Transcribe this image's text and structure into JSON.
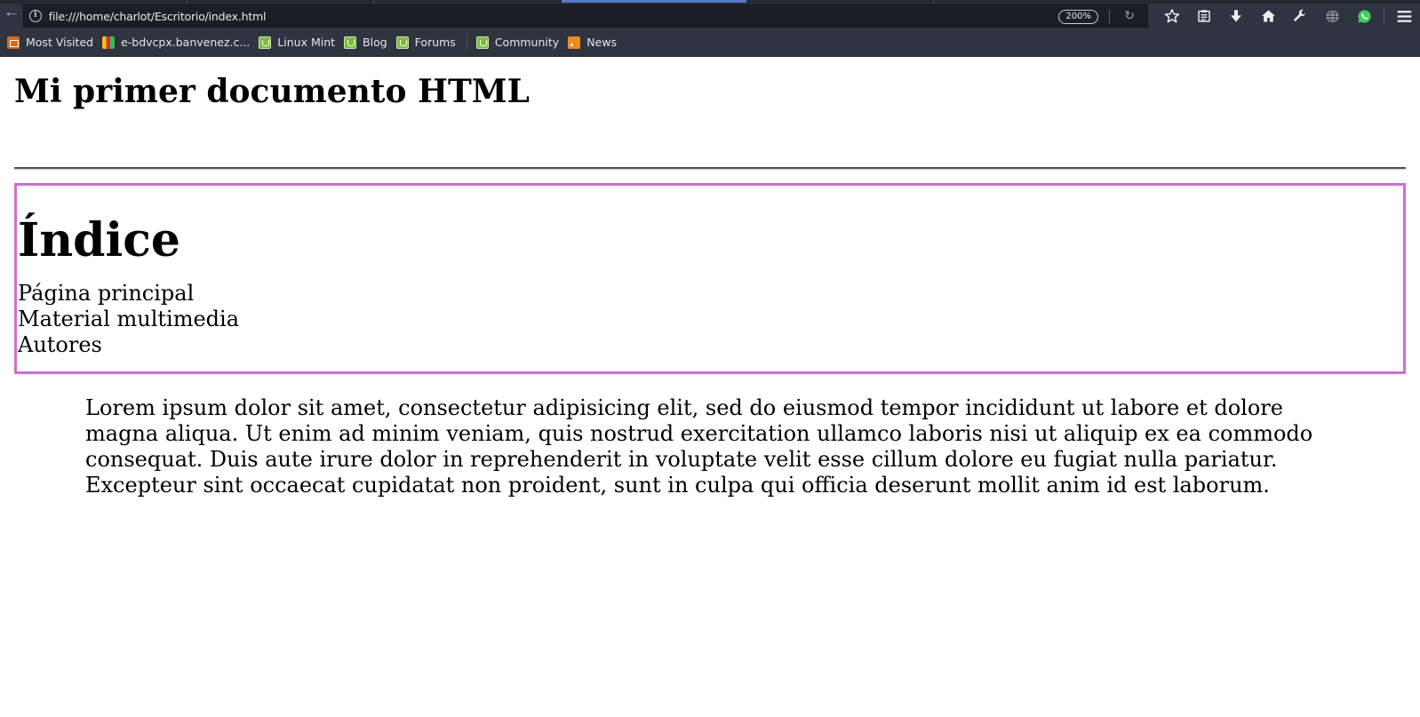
{
  "browser": {
    "url": "file:///home/charlot/Escritorio/index.html",
    "zoom": "200%",
    "toolbar_icons": [
      "star-icon",
      "reading-list-icon",
      "download-icon",
      "home-icon",
      "wrench-icon",
      "globe-icon",
      "whatsapp-icon",
      "menu-icon"
    ],
    "bookmarks": [
      {
        "label": "Most Visited",
        "icon": "folder-icon"
      },
      {
        "label": "e-bdvcpx.banvenez.c...",
        "icon": "bank-favicon"
      },
      {
        "label": "Linux Mint",
        "icon": "mint-favicon"
      },
      {
        "label": "Blog",
        "icon": "mint-favicon"
      },
      {
        "label": "Forums",
        "icon": "mint-favicon"
      },
      {
        "label": "Community",
        "icon": "mint-favicon"
      },
      {
        "label": "News",
        "icon": "rss-icon"
      }
    ]
  },
  "page": {
    "title": "Mi primer documento HTML",
    "index": {
      "heading": "Índice",
      "border_color": "#cf6ed3",
      "items": [
        "Página principal",
        "Material multimedia",
        "Autores"
      ]
    },
    "body_text": "Lorem ipsum dolor sit amet, consectetur adipisicing elit, sed do eiusmod tempor incididunt ut labore et dolore magna aliqua. Ut enim ad minim veniam, quis nostrud exercitation ullamco laboris nisi ut aliquip ex ea commodo consequat. Duis aute irure dolor in reprehenderit in voluptate velit esse cillum dolore eu fugiat nulla pariatur. Excepteur sint occaecat cupidatat non proident, sunt in culpa qui officia deserunt mollit anim id est laborum."
  }
}
